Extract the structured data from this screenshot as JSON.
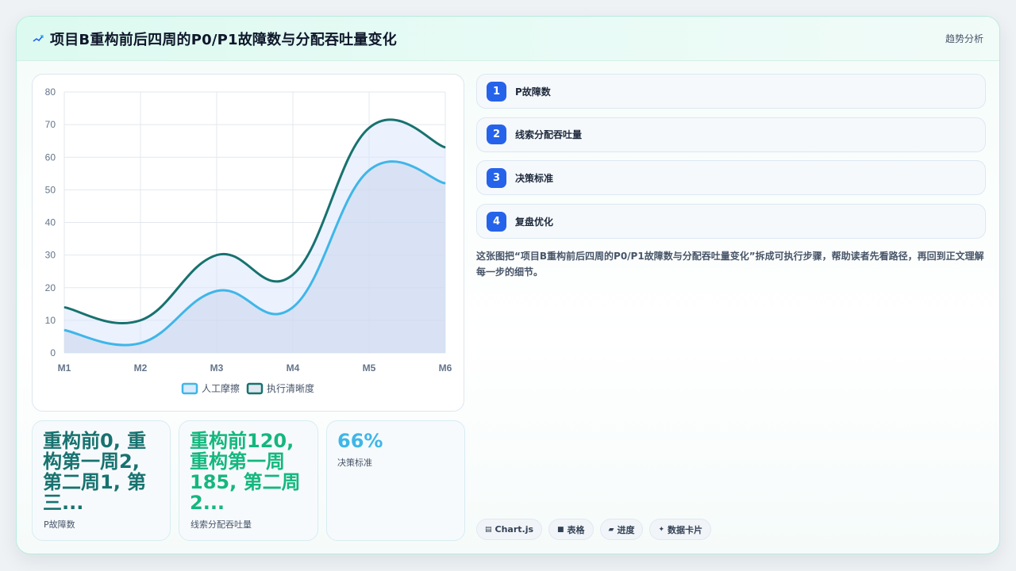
{
  "header": {
    "title": "项目B重构前后四周的P0/P1故障数与分配吞吐量变化",
    "tag": "趋势分析",
    "icon": "trend-line-icon"
  },
  "chart_data": {
    "type": "area",
    "categories": [
      "M1",
      "M2",
      "M3",
      "M4",
      "M5",
      "M6"
    ],
    "ylim": [
      0,
      80
    ],
    "yticks": [
      0,
      10,
      20,
      30,
      40,
      50,
      60,
      70,
      80
    ],
    "grid": true,
    "legend_position": "bottom",
    "series": [
      {
        "name": "人工摩擦",
        "values": [
          7,
          3,
          19,
          14,
          56,
          52
        ],
        "color": "#3fb6e8"
      },
      {
        "name": "执行清晰度",
        "values": [
          14,
          10,
          30,
          24,
          69,
          63
        ],
        "color": "#17726f"
      }
    ]
  },
  "stats": [
    {
      "value": "重构前0, 重构第一周2, 第二周1, 第三...",
      "label": "P故障数",
      "color": "#17726f"
    },
    {
      "value": "重构前120, 重构第一周185, 第二周2...",
      "label": "线索分配吞吐量",
      "color": "#14b77e"
    },
    {
      "value": "66%",
      "label": "决策标准",
      "color": "#3fb6e8"
    }
  ],
  "steps": [
    {
      "num": "1",
      "label": "P故障数"
    },
    {
      "num": "2",
      "label": "线索分配吞吐量"
    },
    {
      "num": "3",
      "label": "决策标准"
    },
    {
      "num": "4",
      "label": "复盘优化"
    }
  ],
  "description": "这张图把“项目B重构前后四周的P0/P1故障数与分配吞吐量变化”拆成可执行步骤，帮助读者先看路径，再回到正文理解每一步的细节。",
  "chips": [
    {
      "icon": "chart-icon",
      "glyph": "▤",
      "label": "Chart.js"
    },
    {
      "icon": "table-icon",
      "glyph": "■",
      "label": "表格"
    },
    {
      "icon": "progress-icon",
      "glyph": "▰",
      "label": "进度"
    },
    {
      "icon": "sparkle-icon",
      "glyph": "✦",
      "label": "数据卡片"
    }
  ]
}
